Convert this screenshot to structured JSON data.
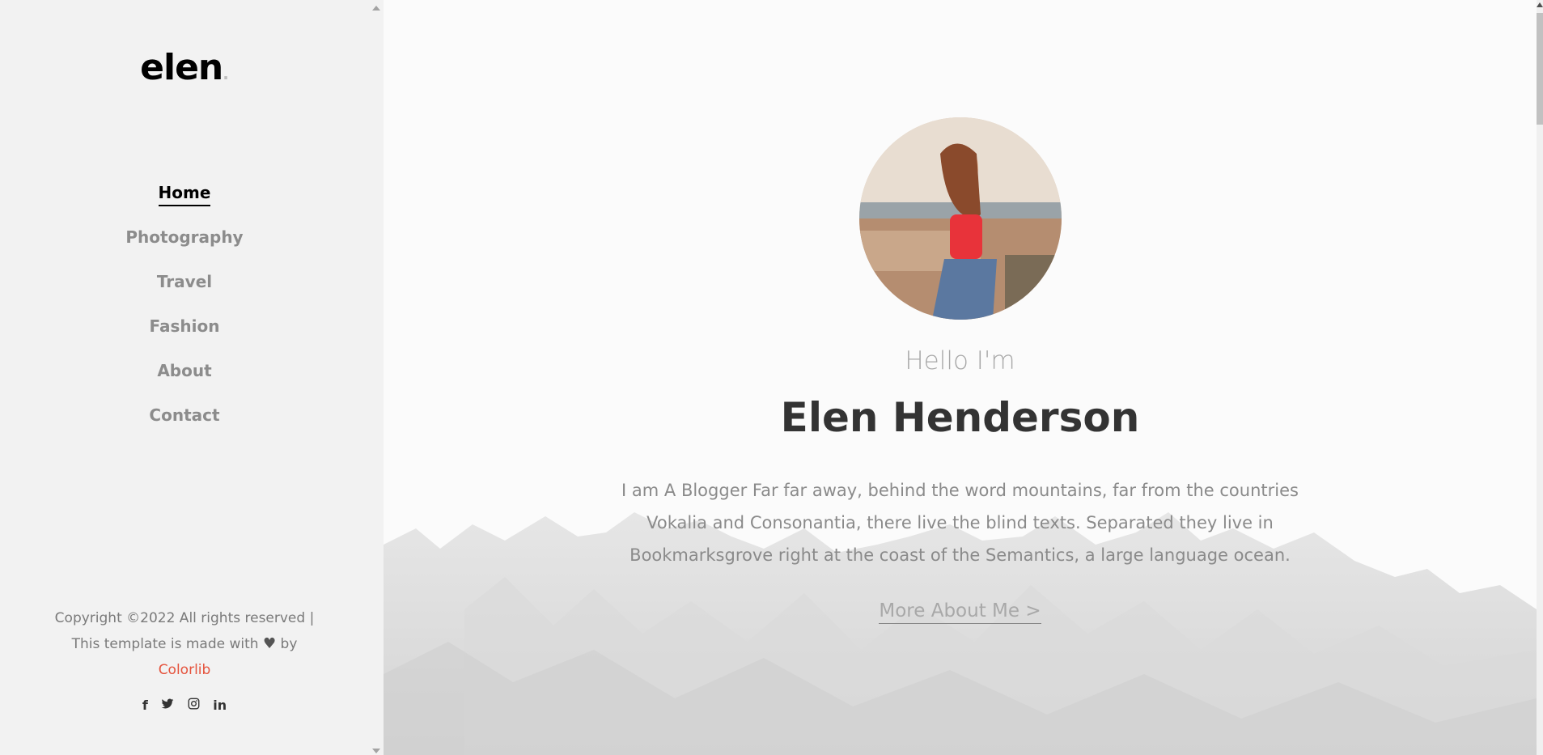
{
  "sidebar": {
    "logo": "elen",
    "logo_dot": ".",
    "nav": [
      {
        "label": "Home"
      },
      {
        "label": "Photography"
      },
      {
        "label": "Travel"
      },
      {
        "label": "Fashion"
      },
      {
        "label": "About"
      },
      {
        "label": "Contact"
      }
    ],
    "active_nav": "Home",
    "copyright_line1": "Copyright ©2022 All rights reserved |",
    "copyright_line2_pre": "This template is made with",
    "copyright_line2_post": "by",
    "brand_link": "Colorlib",
    "social_icons": [
      "facebook-icon",
      "twitter-icon",
      "instagram-icon",
      "linkedin-icon"
    ]
  },
  "hero": {
    "greeting": "Hello I'm",
    "name": "Elen Henderson",
    "bio_line1": "I am A Blogger Far far away, behind the word mountains, far from the countries",
    "bio_line2": "Vokalia and Consonantia, there live the blind texts. Separated they live in",
    "bio_line3": "Bookmarksgrove right at the coast of the Semantics, a large language ocean.",
    "more_link": "More About Me >"
  },
  "colors": {
    "sidebar_bg": "#f2f2f2",
    "accent": "#e5533d",
    "active_nav": "#000000",
    "inactive_nav": "#8c8c8c"
  }
}
